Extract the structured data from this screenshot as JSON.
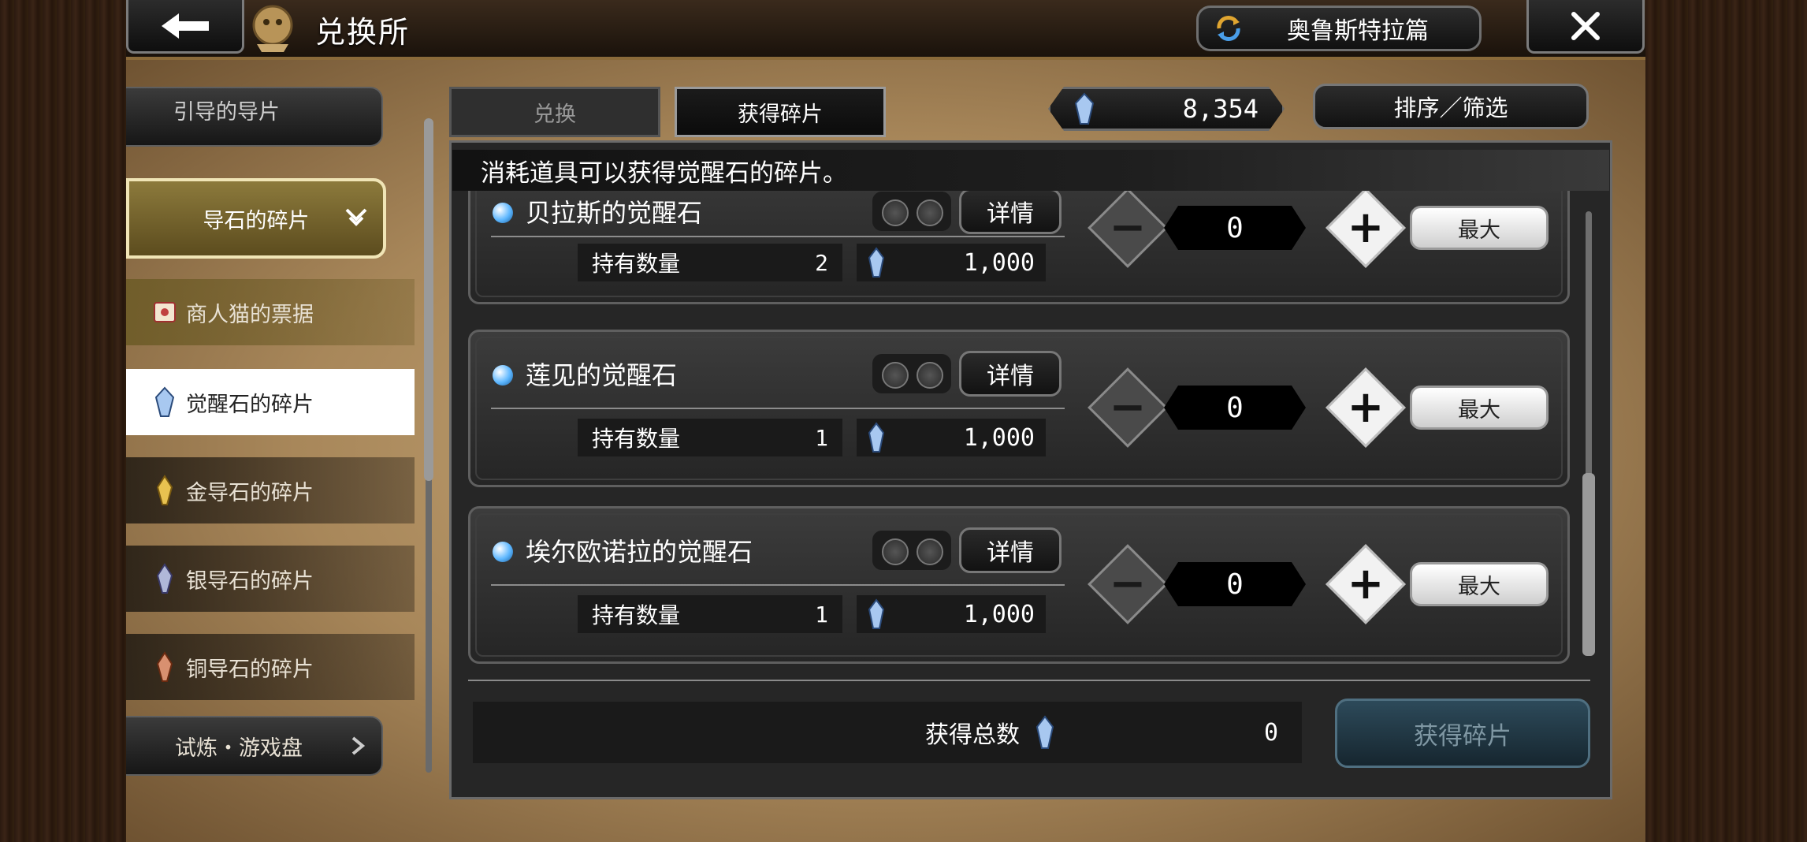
{
  "header": {
    "title": "兑换所",
    "region": "奥鲁斯特拉篇"
  },
  "sidebar": {
    "partial_top_label": "引导的导片",
    "active_category": "导石的碎片",
    "items": [
      {
        "label": "商人猫的票据",
        "icon": "ticket-icon",
        "style": "gold"
      },
      {
        "label": "觉醒石的碎片",
        "icon": "crystal-icon",
        "style": "selected"
      },
      {
        "label": "金导石的碎片",
        "icon": "gold-shard-icon",
        "style": "dark"
      },
      {
        "label": "银导石的碎片",
        "icon": "silver-shard-icon",
        "style": "dark"
      },
      {
        "label": "铜导石的碎片",
        "icon": "copper-shard-icon",
        "style": "dark"
      }
    ],
    "bottom_category": "试炼・游戏盘"
  },
  "tabs": [
    {
      "label": "兑换",
      "active": false
    },
    {
      "label": "获得碎片",
      "active": true
    }
  ],
  "currency": {
    "value": "8,354"
  },
  "sort_button": "排序／筛选",
  "banner": "消耗道具可以获得觉醒石的碎片。",
  "rows": [
    {
      "name": "贝拉斯的觉醒石",
      "held_label": "持有数量",
      "held": "2",
      "cost": "1,000",
      "qty": "0",
      "detail": "详情",
      "max": "最大"
    },
    {
      "name": "莲见的觉醒石",
      "held_label": "持有数量",
      "held": "1",
      "cost": "1,000",
      "qty": "0",
      "detail": "详情",
      "max": "最大"
    },
    {
      "name": "埃尔欧诺拉的觉醒石",
      "held_label": "持有数量",
      "held": "1",
      "cost": "1,000",
      "qty": "0",
      "detail": "详情",
      "max": "最大"
    }
  ],
  "footer": {
    "total_label": "获得总数",
    "total_value": "0",
    "get_button": "获得碎片"
  },
  "colors": {
    "parchment": "#b89a6a",
    "active_category": "#7a6a30",
    "get_button": "#1f3846"
  }
}
